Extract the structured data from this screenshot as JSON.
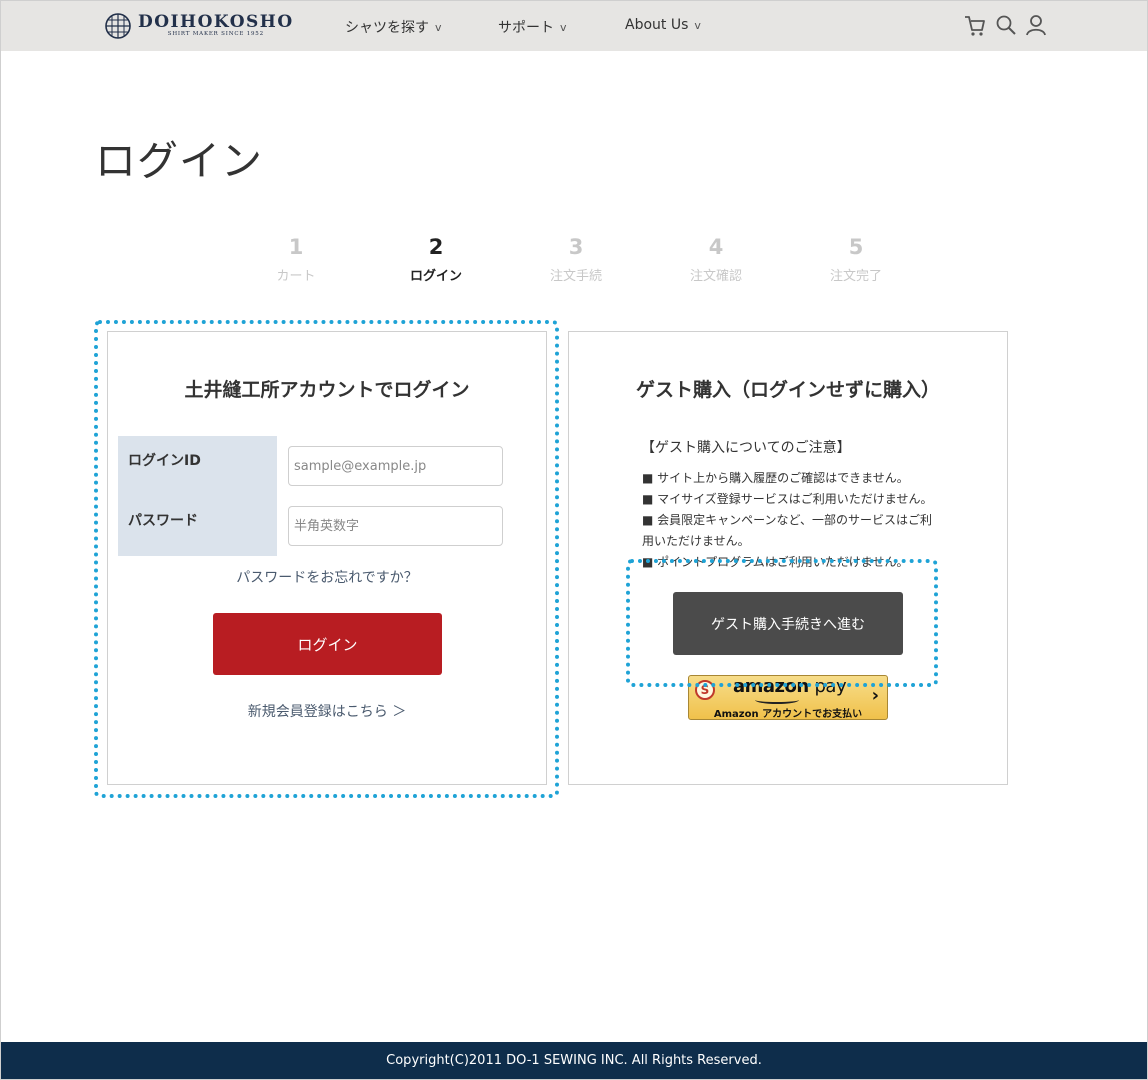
{
  "header": {
    "logo": {
      "name": "DOIHOKOSHO",
      "tagline": "SHIRT MAKER SINCE 1952",
      "icon": "globe-icon"
    },
    "nav": [
      {
        "label": "シャツを探す",
        "chevron": "v"
      },
      {
        "label": "サポート",
        "chevron": "v"
      },
      {
        "label": "About Us",
        "chevron": "v"
      }
    ],
    "icons": [
      "cart-icon",
      "search-icon",
      "user-icon"
    ]
  },
  "page": {
    "title": "ログイン"
  },
  "steps": [
    {
      "num": "1",
      "label": "カート",
      "active": false
    },
    {
      "num": "2",
      "label": "ログイン",
      "active": true
    },
    {
      "num": "3",
      "label": "注文手続",
      "active": false
    },
    {
      "num": "4",
      "label": "注文確認",
      "active": false
    },
    {
      "num": "5",
      "label": "注文完了",
      "active": false
    }
  ],
  "login_panel": {
    "title": "土井縫工所アカウントでログイン",
    "login_id_label": "ログインID",
    "login_id_placeholder": "sample@example.jp",
    "password_label": "パスワード",
    "password_placeholder": "半角英数字",
    "forgot_link": "パスワードをお忘れですか？",
    "login_button": "ログイン",
    "register_link": "新規会員登録はこちら ＞"
  },
  "guest_panel": {
    "title": "ゲスト購入（ログインせずに購入）",
    "notice_title": "【ゲスト購入についてのご注意】",
    "notices": [
      "サイト上から購入履歴のご確認はできません。",
      "マイサイズ登録サービスはご利用いただけません。",
      "会員限定キャンペーンなど、一部のサービスはご利用いただけません。",
      "ポイントプログラムはご利用いただけません。"
    ],
    "guest_button": "ゲスト購入手続きへ進む",
    "amazon": {
      "wordmark": "amazon",
      "pay": "pay",
      "sub": "Amazon アカウントでお支払い",
      "chevron": "›",
      "badge": "S"
    }
  },
  "footer": {
    "copyright": "Copyright(C)2011 DO-1 SEWING INC. All Rights Reserved."
  },
  "colors": {
    "header_bg": "#e6e5e3",
    "login_button": "#b81d22",
    "guest_button": "#4b4b4b",
    "footer_bg": "#0e2d4b",
    "focus_ring": "#1fa3d6",
    "label_bg": "#dbe3ec"
  }
}
